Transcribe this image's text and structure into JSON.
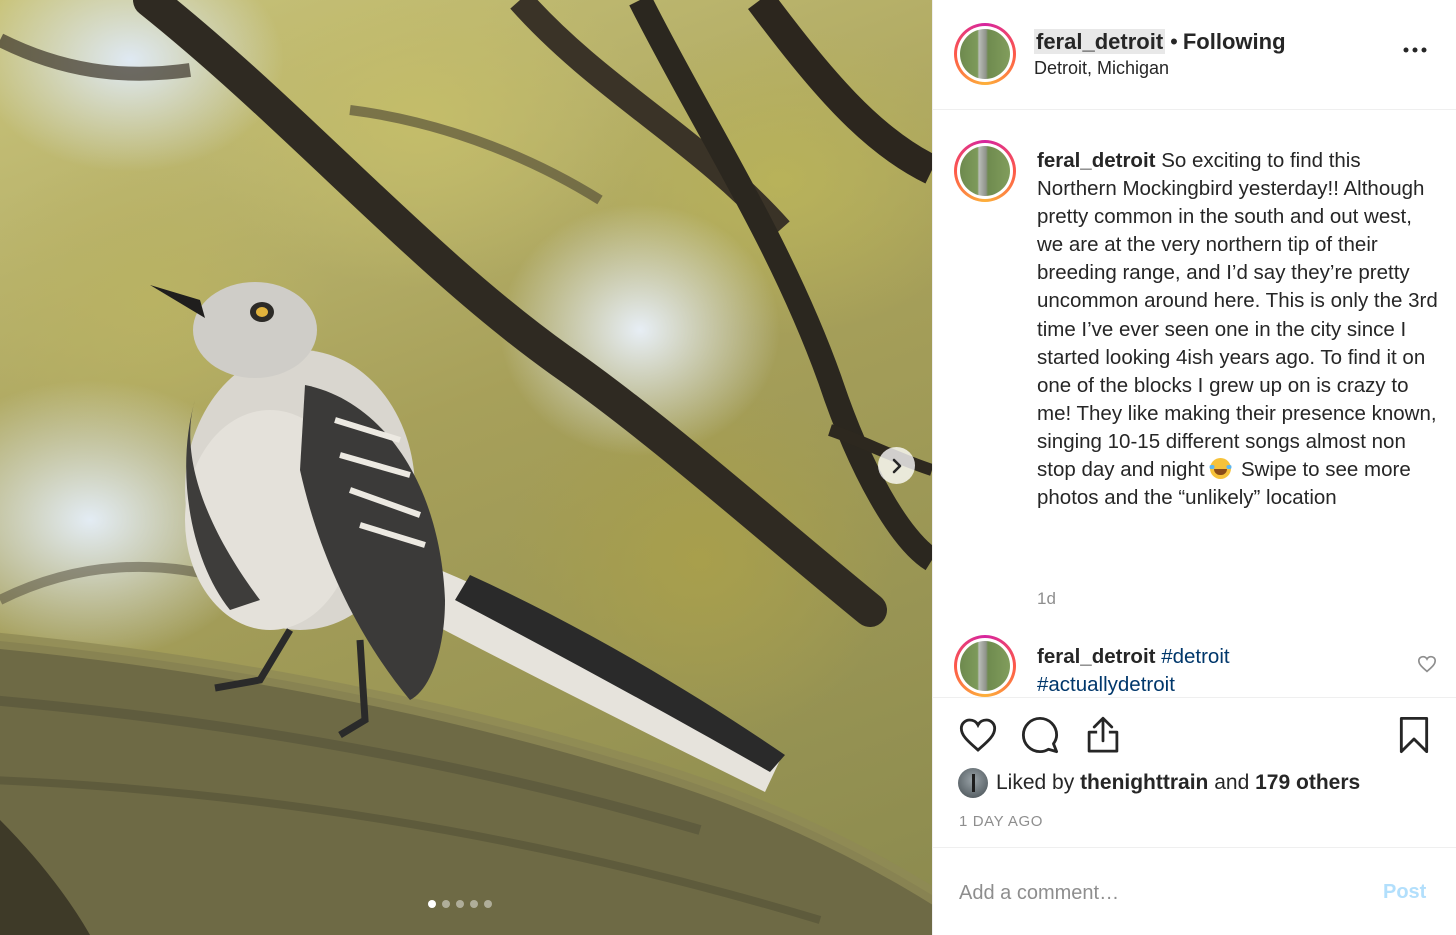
{
  "post": {
    "carousel": {
      "slide_count": 5,
      "active_slide": 1
    },
    "header": {
      "username": "feral_detroit",
      "separator": "•",
      "follow_status": "Following",
      "location": "Detroit, Michigan"
    },
    "caption": {
      "username": "feral_detroit",
      "text_before_emoji": "So exciting to find this Northern Mockingbird yesterday!! Although pretty common in the south and out west, we are at the very northern tip of their breeding range, and I’d say they’re pretty uncommon around here. This is only the 3rd time I’ve ever seen one in the city since I started looking 4ish years ago. To find it on one of the blocks I grew up on is crazy to me! They like making their presence known, singing 10-15 different songs almost non stop day and night",
      "emoji": "laughing-tears-emoji",
      "text_after_emoji": " Swipe to see more photos and the “unlikely” location",
      "timestamp": "1d"
    },
    "reply": {
      "username": "feral_detroit",
      "hashtags": [
        "#detroit",
        "#actuallydetroit"
      ]
    },
    "likes": {
      "prefix": "Liked by",
      "liker": "thenighttrain",
      "conjunction": "and",
      "others": "179 others"
    },
    "posted_ago": "1 DAY AGO",
    "comment": {
      "placeholder": "Add a comment…",
      "post_label": "Post"
    },
    "colors": {
      "text": "#262626",
      "muted": "#8e8e8e",
      "hashtag": "#00376b",
      "post_disabled": "#b2dffc"
    }
  }
}
